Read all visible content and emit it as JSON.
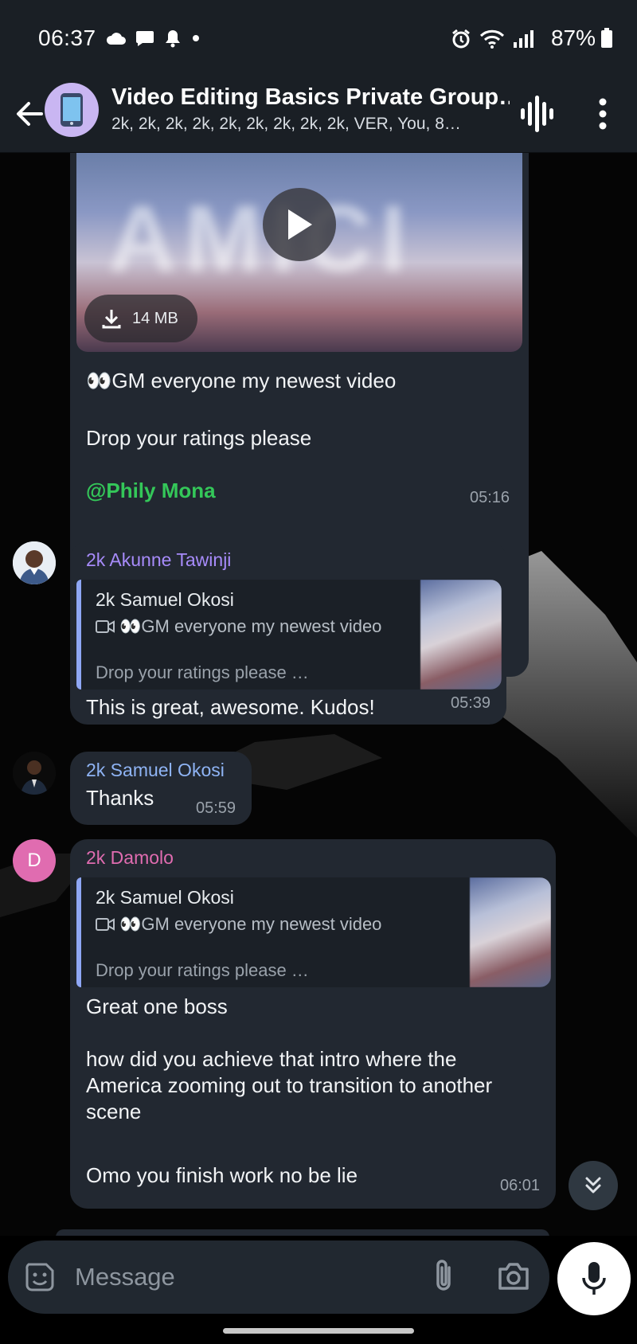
{
  "status_bar": {
    "time": "06:37",
    "battery": "87%",
    "icons": [
      "cloud-icon",
      "chat-icon",
      "bell-icon",
      "dot-icon",
      "alarm-icon",
      "wifi-icon",
      "signal-icon",
      "battery-icon"
    ]
  },
  "header": {
    "title": "Video Editing Basics Private Group…",
    "subtitle": "2k, 2k, 2k, 2k, 2k, 2k, 2k, 2k, 2k, VER, You, 8…"
  },
  "messages": {
    "video": {
      "download_size": "14 MB",
      "line1": "👀GM everyone my newest video",
      "line2": "Drop your ratings please",
      "mention": "@Phily Mona",
      "time": "05:16",
      "thumb_text": "AMICI"
    },
    "akunne": {
      "sender": "2k Akunne Tawinji",
      "reply_name": "2k Samuel Okosi",
      "reply_line1": "👀GM everyone my newest video",
      "reply_line2": "Drop your ratings please …",
      "text": "This is great, awesome. Kudos!",
      "time": "05:39"
    },
    "samuel": {
      "sender": "2k Samuel Okosi",
      "text": "Thanks",
      "time": "05:59"
    },
    "damolo": {
      "sender": "2k Damolo",
      "avatar_letter": "D",
      "reply_name": "2k Samuel Okosi",
      "reply_line1": "👀GM everyone my newest video",
      "reply_line2": "Drop your ratings please …",
      "text1": "Great one boss",
      "text2": "how did you achieve that intro where the\nAmerica zooming out to transition to another\nscene",
      "text3": "Omo you finish work no be lie",
      "time": "06:01"
    }
  },
  "input": {
    "placeholder": "Message"
  },
  "colors": {
    "accent_purple": "#a78bfa",
    "sender_blue": "#8fb4f5",
    "sender_pink": "#e06cb0",
    "mention_green": "#34c759",
    "bubble": "#222831"
  }
}
